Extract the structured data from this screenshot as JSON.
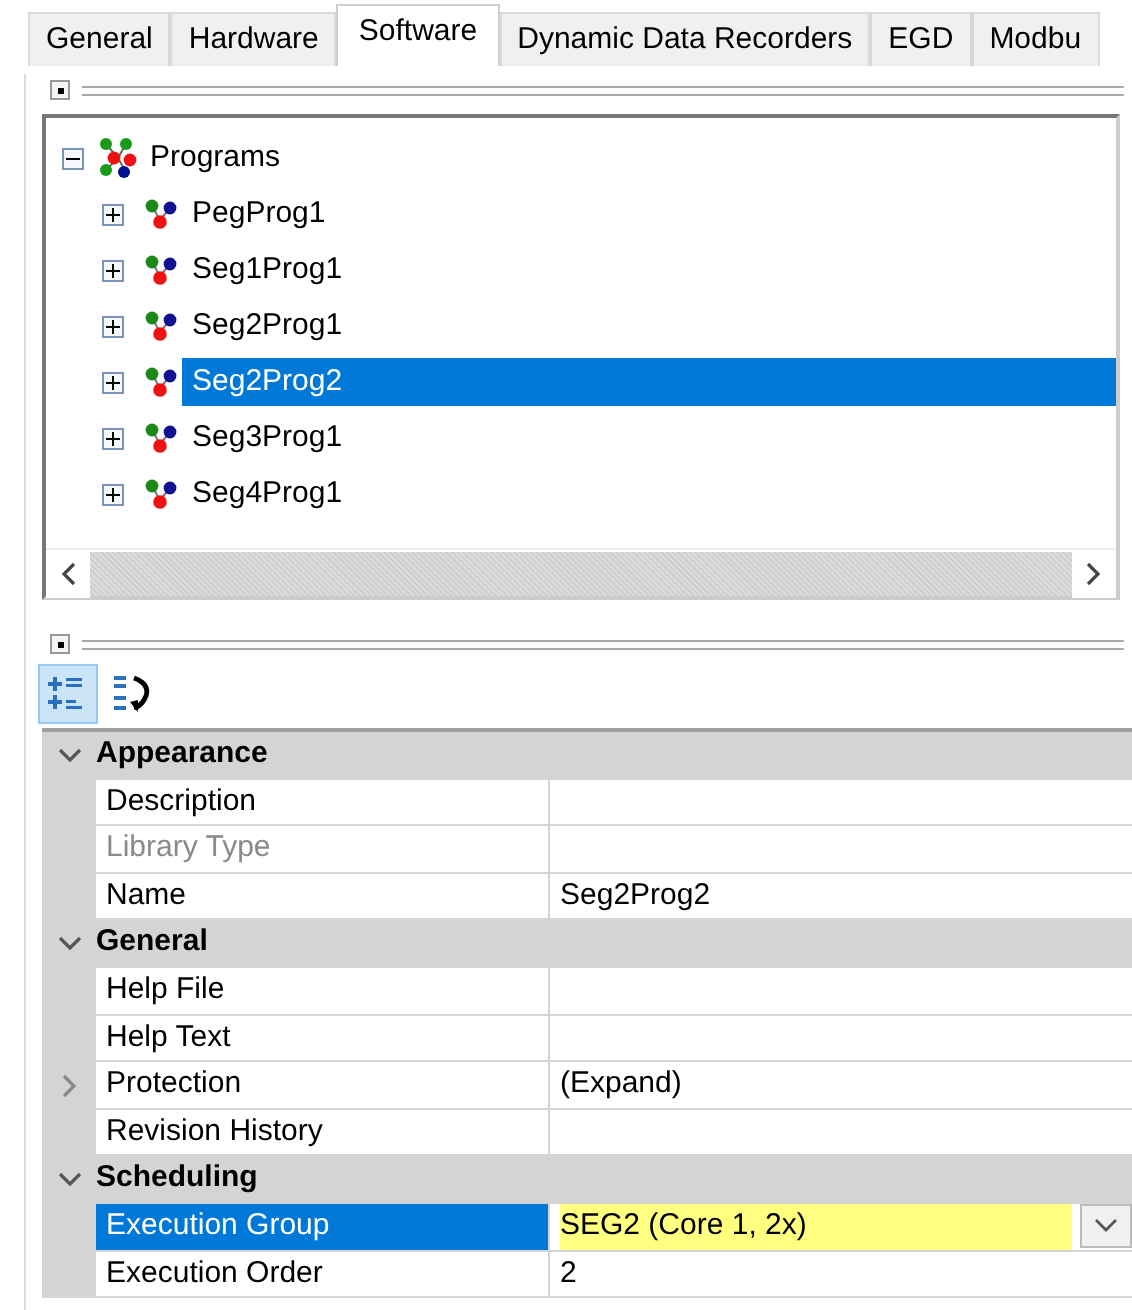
{
  "tabs": [
    {
      "label": "General",
      "selected": false
    },
    {
      "label": "Hardware",
      "selected": false
    },
    {
      "label": "Software",
      "selected": true
    },
    {
      "label": "Dynamic Data Recorders",
      "selected": false
    },
    {
      "label": "EGD",
      "selected": false
    },
    {
      "label": "Modbu",
      "selected": false
    }
  ],
  "tree": {
    "label": "Programs",
    "expanded": true,
    "selected": false,
    "children": [
      {
        "label": "PegProg1",
        "expanded": false,
        "selected": false
      },
      {
        "label": "Seg1Prog1",
        "expanded": false,
        "selected": false
      },
      {
        "label": "Seg2Prog1",
        "expanded": false,
        "selected": false
      },
      {
        "label": "Seg2Prog2",
        "expanded": false,
        "selected": true
      },
      {
        "label": "Seg3Prog1",
        "expanded": false,
        "selected": false
      },
      {
        "label": "Seg4Prog1",
        "expanded": false,
        "selected": false
      }
    ]
  },
  "toolbar": [
    {
      "kind": "categorized",
      "selected": true
    },
    {
      "kind": "alphabetical",
      "selected": false
    }
  ],
  "properties": [
    {
      "kind": "category",
      "label": "Appearance",
      "expanded": true
    },
    {
      "kind": "property",
      "label": "Description",
      "disabled": false,
      "selected": false
    },
    {
      "kind": "property",
      "label": "Library Type",
      "disabled": true,
      "selected": false
    },
    {
      "kind": "property",
      "label": "Name",
      "value": "Seg2Prog2",
      "disabled": false,
      "selected": false
    },
    {
      "kind": "category",
      "label": "General",
      "expanded": true
    },
    {
      "kind": "property",
      "label": "Help File",
      "disabled": false,
      "selected": false
    },
    {
      "kind": "property",
      "label": "Help Text",
      "disabled": false,
      "selected": false
    },
    {
      "kind": "property",
      "label": "Protection",
      "value": "(Expand)",
      "disabled": false,
      "selected": false,
      "expanded": false
    },
    {
      "kind": "property",
      "label": "Revision History",
      "disabled": false,
      "selected": false
    },
    {
      "kind": "category",
      "label": "Scheduling",
      "expanded": true
    },
    {
      "kind": "property",
      "label": "Execution Group",
      "value": "SEG2 (Core 1, 2x)",
      "disabled": false,
      "selected": true,
      "modified": true
    },
    {
      "kind": "property",
      "label": "Execution Order",
      "value": "2",
      "disabled": false,
      "selected": false
    }
  ]
}
